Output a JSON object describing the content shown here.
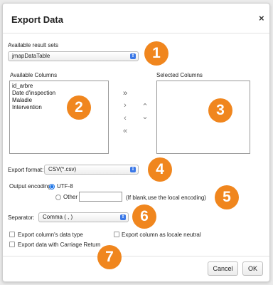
{
  "dialog": {
    "title": "Export Data",
    "close_icon": "×"
  },
  "result_sets": {
    "label": "Available result sets",
    "selected": "jmapDataTable"
  },
  "available_columns": {
    "label": "Available Columns",
    "items": [
      "id_arbre",
      "Date d'inspection",
      "Maladie",
      "Intervention"
    ]
  },
  "selected_columns": {
    "label": "Selected Columns"
  },
  "transfer": {
    "add_all": "»",
    "add": "›",
    "remove": "‹",
    "remove_all": "«",
    "move_up": "⌃",
    "move_down": "⌄"
  },
  "export_format": {
    "label": "Export format:",
    "selected": "CSV(*.csv)"
  },
  "output_encoding": {
    "label": "Output encoding:",
    "utf8_label": "UTF-8",
    "other_label": "Other",
    "other_value": "",
    "hint": "(If blank,use the local encoding)"
  },
  "separator": {
    "label": "Separator:",
    "selected": "Comma ( , )"
  },
  "options": {
    "datatype_label": "Export column's data type",
    "locale_label": "Export column as locale neutral",
    "carriage_label": "Export data with Carriage Return"
  },
  "buttons": {
    "cancel": "Cancel",
    "ok": "OK"
  },
  "callouts": [
    "1",
    "2",
    "3",
    "4",
    "5",
    "6",
    "7"
  ],
  "colors": {
    "callout": "#f0861e",
    "select_arrow": "#3b78e7"
  }
}
